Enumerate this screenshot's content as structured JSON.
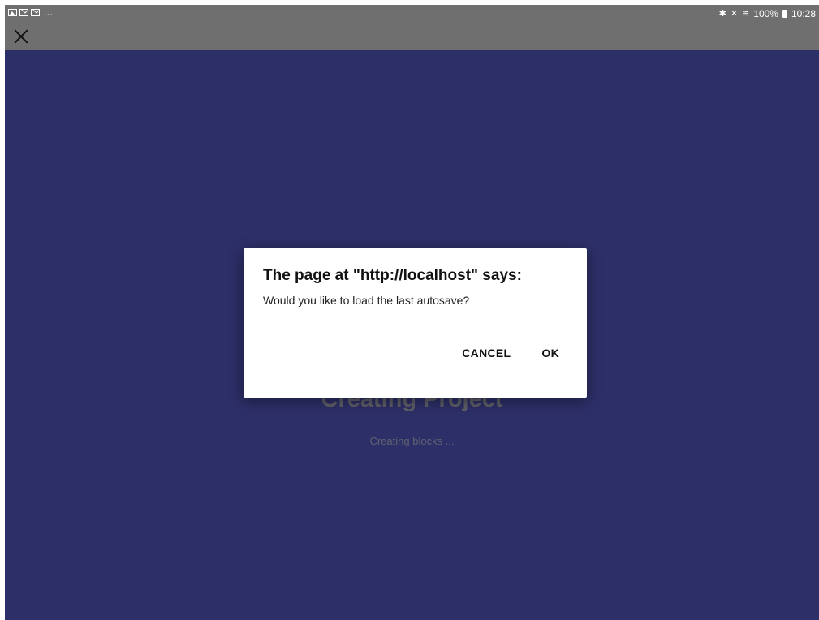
{
  "status_bar": {
    "left_icons": [
      "image-icon",
      "gmail-icon",
      "mail-icon"
    ],
    "overflow": "...",
    "right_icons": [
      "bluetooth-icon",
      "mute-icon",
      "wifi-icon"
    ],
    "battery": "100%",
    "time": "10:28"
  },
  "toolbar": {
    "close_icon": "close-icon"
  },
  "background": {
    "color": "#2d2f68",
    "title": "Creating Project",
    "subtitle": "Creating blocks ..."
  },
  "dialog": {
    "title": "The page at \"http://localhost\" says:",
    "message": "Would you like to load the last autosave?",
    "cancel_label": "CANCEL",
    "ok_label": "OK"
  }
}
